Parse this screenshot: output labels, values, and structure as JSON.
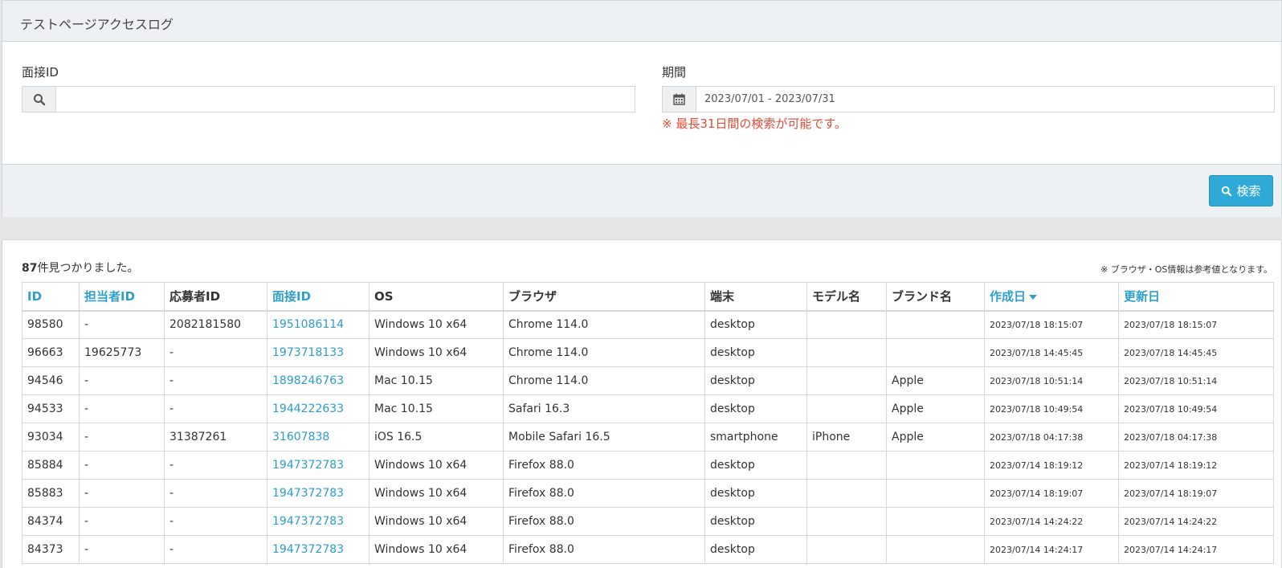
{
  "search": {
    "title": "テストページアクセスログ",
    "interview_id_label": "面接ID",
    "interview_id_value": "",
    "period_label": "期間",
    "period_value": "2023/07/01 - 2023/07/31",
    "period_note": "※ 最長31日間の検索が可能です。",
    "search_button": "検索",
    "icons": {
      "search": "search-icon",
      "calendar": "calendar-icon"
    }
  },
  "results": {
    "count_number": "87",
    "count_suffix": "件見つかりました。",
    "reference_note": "※ ブラウザ・OS情報は参考値となります。",
    "sort_column": "作成日",
    "columns": [
      "ID",
      "担当者ID",
      "応募者ID",
      "面接ID",
      "OS",
      "ブラウザ",
      "端末",
      "モデル名",
      "ブランド名",
      "作成日",
      "更新日"
    ],
    "rows": [
      [
        "98580",
        "-",
        "2082181580",
        "1951086114",
        "Windows 10 x64",
        "Chrome 114.0",
        "desktop",
        "",
        "",
        "2023/07/18 18:15:07",
        "2023/07/18 18:15:07"
      ],
      [
        "96663",
        "19625773",
        "-",
        "1973718133",
        "Windows 10 x64",
        "Chrome 114.0",
        "desktop",
        "",
        "",
        "2023/07/18 14:45:45",
        "2023/07/18 14:45:45"
      ],
      [
        "94546",
        "-",
        "-",
        "1898246763",
        "Mac 10.15",
        "Chrome 114.0",
        "desktop",
        "",
        "Apple",
        "2023/07/18 10:51:14",
        "2023/07/18 10:51:14"
      ],
      [
        "94533",
        "-",
        "-",
        "1944222633",
        "Mac 10.15",
        "Safari 16.3",
        "desktop",
        "",
        "Apple",
        "2023/07/18 10:49:54",
        "2023/07/18 10:49:54"
      ],
      [
        "93034",
        "-",
        "31387261",
        "31607838",
        "iOS 16.5",
        "Mobile Safari 16.5",
        "smartphone",
        "iPhone",
        "Apple",
        "2023/07/18 04:17:38",
        "2023/07/18 04:17:38"
      ],
      [
        "85884",
        "-",
        "-",
        "1947372783",
        "Windows 10 x64",
        "Firefox 88.0",
        "desktop",
        "",
        "",
        "2023/07/14 18:19:12",
        "2023/07/14 18:19:12"
      ],
      [
        "85883",
        "-",
        "-",
        "1947372783",
        "Windows 10 x64",
        "Firefox 88.0",
        "desktop",
        "",
        "",
        "2023/07/14 18:19:07",
        "2023/07/14 18:19:07"
      ],
      [
        "84374",
        "-",
        "-",
        "1947372783",
        "Windows 10 x64",
        "Firefox 88.0",
        "desktop",
        "",
        "",
        "2023/07/14 14:24:22",
        "2023/07/14 14:24:22"
      ],
      [
        "84373",
        "-",
        "-",
        "1947372783",
        "Windows 10 x64",
        "Firefox 88.0",
        "desktop",
        "",
        "",
        "2023/07/14 14:24:17",
        "2023/07/14 14:24:17"
      ]
    ]
  },
  "colors": {
    "accent": "#2fa9d8",
    "link": "#2c9ccc",
    "note": "#dd4b39"
  }
}
